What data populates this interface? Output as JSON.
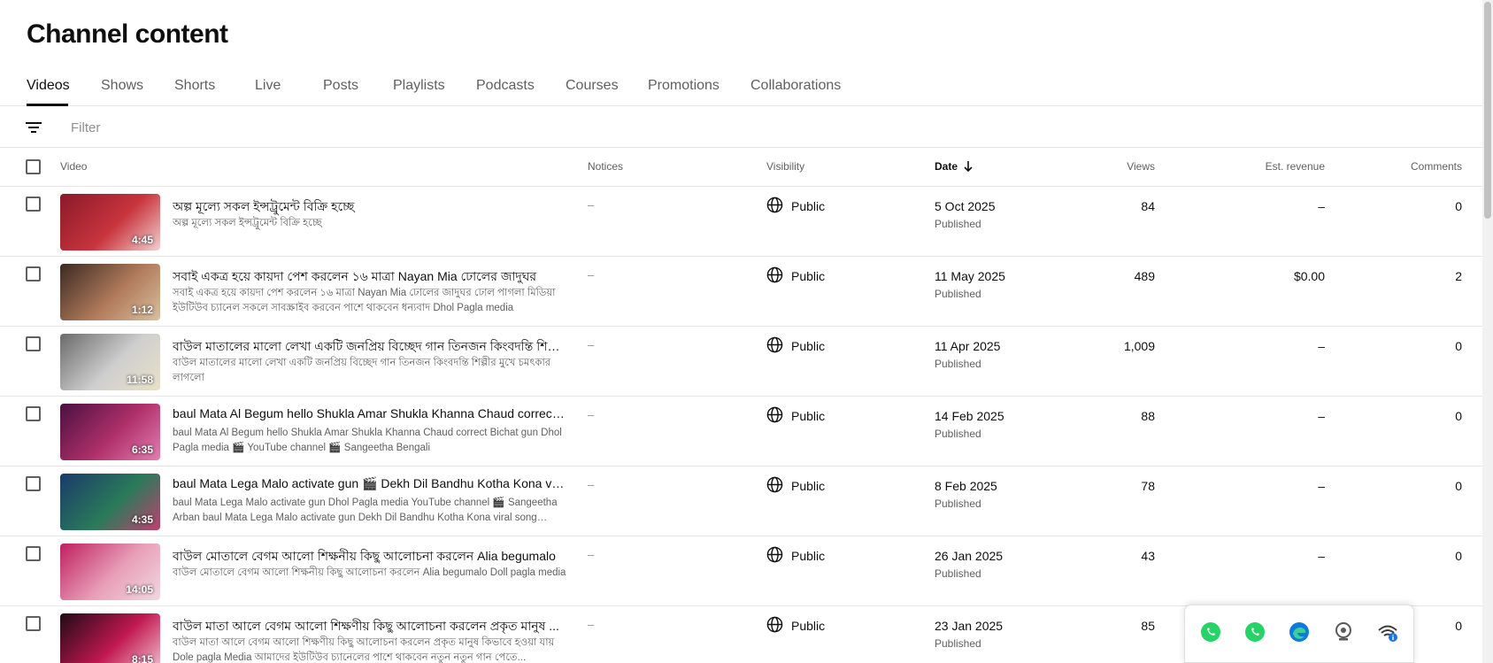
{
  "page": {
    "title": "Channel content"
  },
  "tabs": [
    {
      "label": "Videos",
      "active": true
    },
    {
      "label": "Shows"
    },
    {
      "label": "Shorts"
    },
    {
      "label": "Live"
    },
    {
      "label": "Posts"
    },
    {
      "label": "Playlists"
    },
    {
      "label": "Podcasts"
    },
    {
      "label": "Courses"
    },
    {
      "label": "Promotions"
    },
    {
      "label": "Collaborations"
    }
  ],
  "filter": {
    "placeholder": "Filter",
    "icon": "filter-icon"
  },
  "columns": {
    "video": "Video",
    "notices": "Notices",
    "visibility": "Visibility",
    "date": "Date",
    "views": "Views",
    "revenue": "Est. revenue",
    "comments": "Comments",
    "sort_icon": "arrow-down-icon"
  },
  "videos": [
    {
      "duration": "4:45",
      "title": "অল্প মূল্যে সকল ইন্সট্রুমেন্ট বিক্রি হচ্ছে",
      "description": "অল্প মূল্যে সকল ইন্সট্রুমেন্ট বিক্রি হচ্ছে",
      "notices": "–",
      "visibility": "Public",
      "date": "5 Oct 2025",
      "status": "Published",
      "views": "84",
      "revenue": "–",
      "comments": "0",
      "thumb_colors": [
        "#8a1a2a",
        "#c8343c",
        "#f0d0d0"
      ]
    },
    {
      "duration": "1:12",
      "title": "সবাই একত্র হয়ে কায়দা পেশ করলেন ১৬ মাত্রা Nayan Mia ঢোলের জাদুঘর",
      "description": "সবাই একত্র হয়ে কায়দা পেশ করলেন ১৬ মাত্রা Nayan Mia ঢোলের জাদুঘর ঢোল পাগলা মিডিয়া ইউটিউব চ্যানেল সকলে সাবস্ক্রাইব করবেন পাশে থাকবেন ধন্যবাদ Dhol Pagla media",
      "notices": "–",
      "visibility": "Public",
      "date": "11 May 2025",
      "status": "Published",
      "views": "489",
      "revenue": "$0.00",
      "comments": "2",
      "thumb_colors": [
        "#3a2a22",
        "#b07a5a",
        "#d8c0a0"
      ]
    },
    {
      "duration": "11:58",
      "title": "বাউল মাতালের মালো লেখা একটি জনপ্রিয় বিচ্ছেদ গান তিনজন কিংবদন্তি শিল্পী...",
      "description": "বাউল মাতালের মালো লেখা একটি জনপ্রিয় বিচ্ছেদ গান তিনজন কিংবদন্তি শিল্পীর মুখে চমৎকার লাগলো",
      "notices": "–",
      "visibility": "Public",
      "date": "11 Apr 2025",
      "status": "Published",
      "views": "1,009",
      "revenue": "–",
      "comments": "0",
      "thumb_colors": [
        "#6a6a6a",
        "#cfcfcf",
        "#e8e0c8"
      ]
    },
    {
      "duration": "6:35",
      "title": "baul Mata Al Begum hello Shukla Amar Shukla Khanna Chaud correct Bich...",
      "description": "baul Mata Al Begum hello Shukla Amar Shukla Khanna Chaud correct Bichat gun Dhol Pagla media 🎬 YouTube channel 🎬 Sangeetha Bengali",
      "notices": "–",
      "visibility": "Public",
      "date": "14 Feb 2025",
      "status": "Published",
      "views": "88",
      "revenue": "–",
      "comments": "0",
      "thumb_colors": [
        "#4a1040",
        "#b0306a",
        "#e080b0"
      ]
    },
    {
      "duration": "4:35",
      "title": "baul Mata Lega Malo activate gun 🎬 Dekh Dil Bandhu Kotha Kona viral so...",
      "description": "baul Mata Lega Malo activate gun Dhol Pagla media YouTube channel 🎬 Sangeetha Arban baul Mata Lega Malo activate gun Dekh Dil Bandhu Kotha Kona viral song Alya...",
      "notices": "–",
      "visibility": "Public",
      "date": "8 Feb 2025",
      "status": "Published",
      "views": "78",
      "revenue": "–",
      "comments": "0",
      "thumb_colors": [
        "#1a3a6a",
        "#2a7a5a",
        "#c04070"
      ]
    },
    {
      "duration": "14:05",
      "title": "বাউল মোতালে বেগম আলো শিক্ষনীয় কিছু আলোচনা করলেন Alia begumalo",
      "description": "বাউল মোতালে বেগম আলো শিক্ষনীয় কিছু আলোচনা করলেন Alia begumalo Doll pagla media",
      "notices": "–",
      "visibility": "Public",
      "date": "26 Jan 2025",
      "status": "Published",
      "views": "43",
      "revenue": "–",
      "comments": "0",
      "thumb_colors": [
        "#c02060",
        "#e8a0b8",
        "#f0d8e0"
      ]
    },
    {
      "duration": "8:15",
      "title": "বাউল মাতা আলে বেগম আলো শিক্ষণীয় কিছু আলোচনা করলেন প্রকৃত মানুষ ...",
      "description": "বাউল মাতা আলে বেগম আলো শিক্ষণীয় কিছু আলোচনা করলেন প্রকৃত মানুষ কিভাবে হওয়া যায় Dole pagla Media আমাদের ইউটিউব চ্যানেলের পাশে থাকবেন নতুন নতুন গান পেতে...",
      "notices": "–",
      "visibility": "Public",
      "date": "23 Jan 2025",
      "status": "Published",
      "views": "85",
      "revenue": "",
      "comments": "0",
      "thumb_colors": [
        "#200a14",
        "#c01850",
        "#f0c0d0"
      ]
    }
  ],
  "tray": [
    {
      "icon": "whatsapp-icon",
      "color": "#25d366"
    },
    {
      "icon": "whatsapp-icon",
      "color": "#25d366"
    },
    {
      "icon": "edge-browser-icon",
      "color": "#0c7bd9"
    },
    {
      "icon": "webcam-icon",
      "color": "#5a5a5a"
    },
    {
      "icon": "network-info-icon",
      "color": "#3a3a3a"
    }
  ]
}
